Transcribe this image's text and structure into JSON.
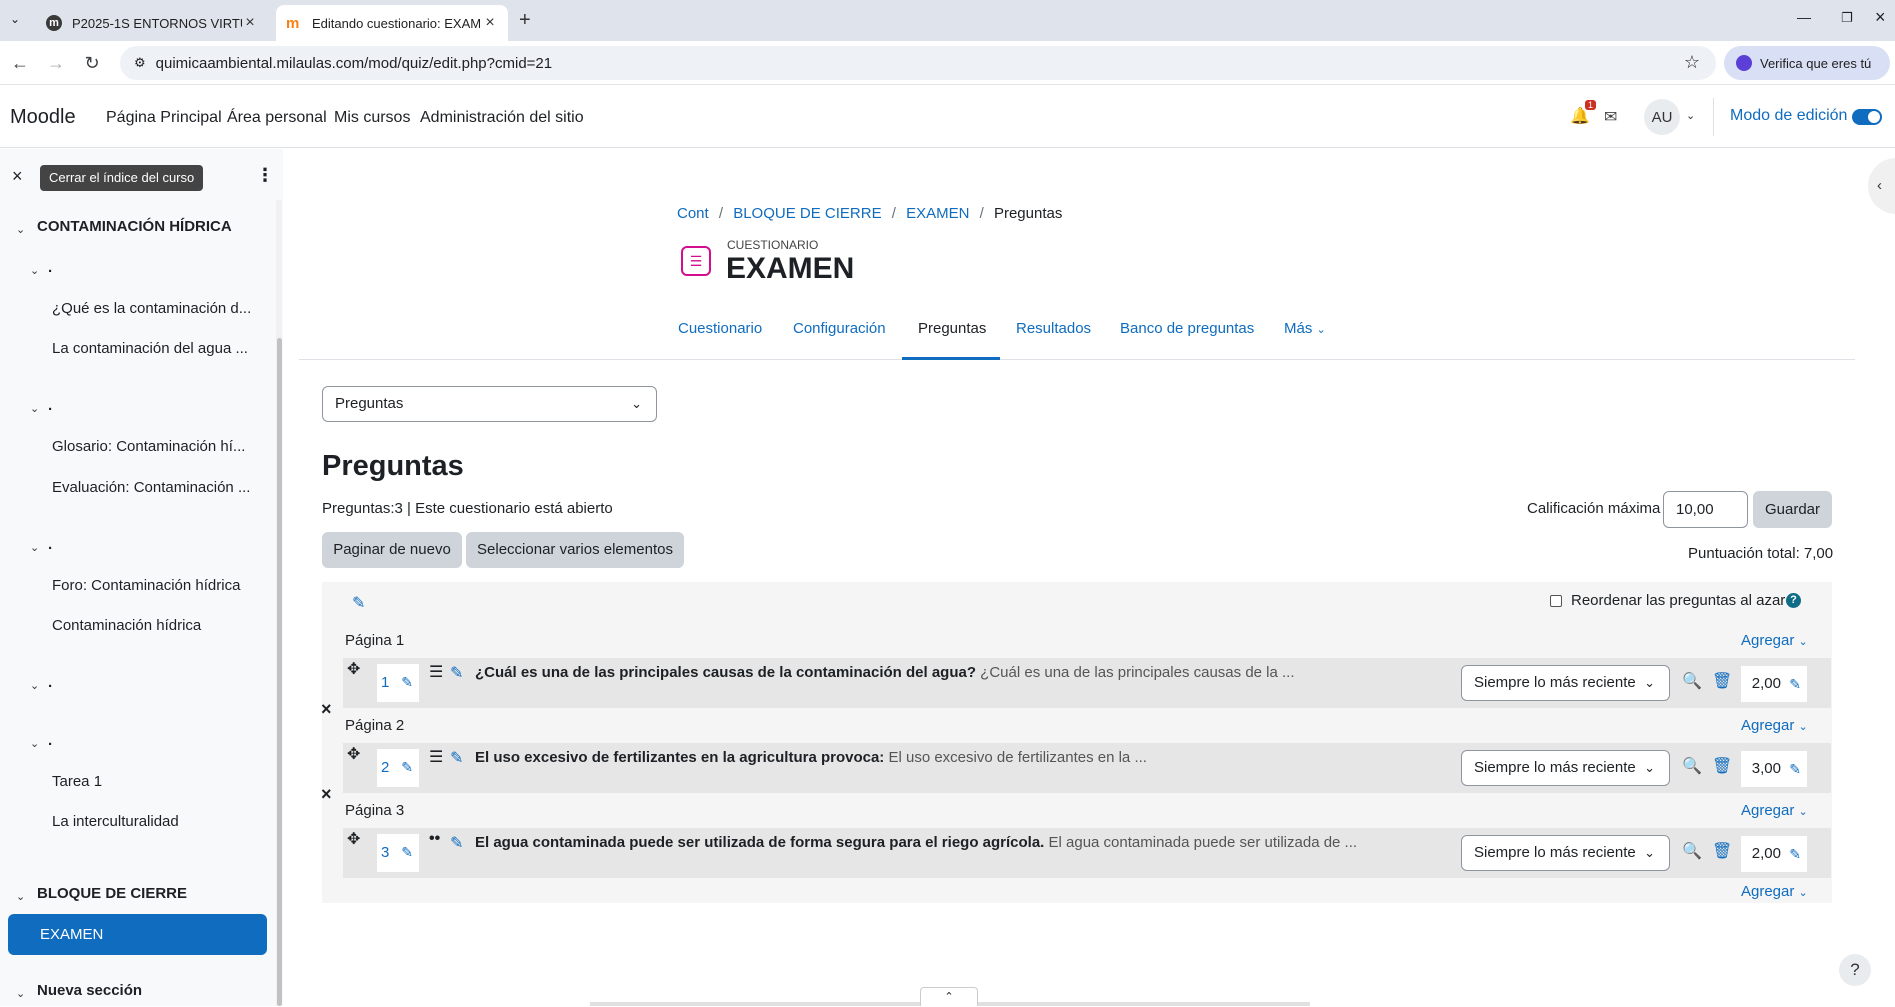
{
  "browser": {
    "tabs": [
      {
        "title": "P2025-1S ENTORNOS VIRTUALES"
      },
      {
        "title": "Editando cuestionario: EXAMEN"
      }
    ],
    "url": "quimicaambiental.milaulas.com/mod/quiz/edit.php?cmid=21",
    "verify_label": "Verifica que eres tú"
  },
  "navbar": {
    "brand": "Moodle",
    "links": [
      "Página Principal",
      "Área personal",
      "Mis cursos",
      "Administración del sitio"
    ],
    "notification_count": "1",
    "avatar": "AU",
    "edit_mode_label": "Modo de edición",
    "edit_mode_on": true
  },
  "drawer": {
    "close_tooltip": "Cerrar el índice del curso",
    "sections": [
      {
        "label": "CONTAMINACIÓN HÍDRICA"
      },
      {
        "label": ".",
        "items": [
          "¿Qué es la contaminación d...",
          "La contaminación del agua ..."
        ]
      },
      {
        "label": ".",
        "items": [
          "Glosario: Contaminación hí...",
          "Evaluación: Contaminación ..."
        ]
      },
      {
        "label": ".",
        "items": [
          "Foro: Contaminación hídrica",
          "Contaminación hídrica"
        ]
      },
      {
        "label": "."
      },
      {
        "label": ".",
        "items": [
          "Tarea 1",
          "La interculturalidad"
        ]
      },
      {
        "label": "BLOQUE DE CIERRE",
        "items": [
          "EXAMEN"
        ]
      },
      {
        "label": "Nueva sección"
      }
    ]
  },
  "breadcrumb": [
    "Cont",
    "BLOQUE DE CIERRE",
    "EXAMEN",
    "Preguntas"
  ],
  "header": {
    "type_label": "CUESTIONARIO",
    "title": "EXAMEN"
  },
  "secondary_nav": [
    "Cuestionario",
    "Configuración",
    "Preguntas",
    "Resultados",
    "Banco de preguntas",
    "Más"
  ],
  "secondary_nav_active": "Preguntas",
  "questions_select": "Preguntas",
  "heading": "Preguntas",
  "info": "Preguntas:3 | Este cuestionario está abierto",
  "buttons": {
    "repaginate": "Paginar de nuevo",
    "select_multiple": "Seleccionar varios elementos",
    "save": "Guardar"
  },
  "max_grade_label": "Calificación máxima",
  "max_grade": "10,00",
  "total_label": "Puntuación total: 7,00",
  "shuffle_label": "Reordenar las preguntas al azar",
  "add_label": "Agregar",
  "pages": [
    {
      "label": "Página 1",
      "question": {
        "num": "1",
        "type_icon": "list-icon",
        "bold": "¿Cuál es una de las principales causas de la contaminación del agua?",
        "preview": "¿Cuál es una de las principales causas de la ...",
        "version": "Siempre lo más reciente",
        "mark": "2,00"
      }
    },
    {
      "label": "Página 2",
      "question": {
        "num": "2",
        "type_icon": "list-icon",
        "bold": "El uso excesivo de fertilizantes en la agricultura provoca:",
        "preview": "El uso excesivo de fertilizantes en la ...",
        "version": "Siempre lo más reciente",
        "mark": "3,00"
      }
    },
    {
      "label": "Página 3",
      "question": {
        "num": "3",
        "type_icon": "dots-icon",
        "bold": "El agua contaminada puede ser utilizada de forma segura para el riego agrícola.",
        "preview": "El agua contaminada puede ser utilizada de ...",
        "version": "Siempre lo más reciente",
        "mark": "2,00"
      }
    }
  ]
}
